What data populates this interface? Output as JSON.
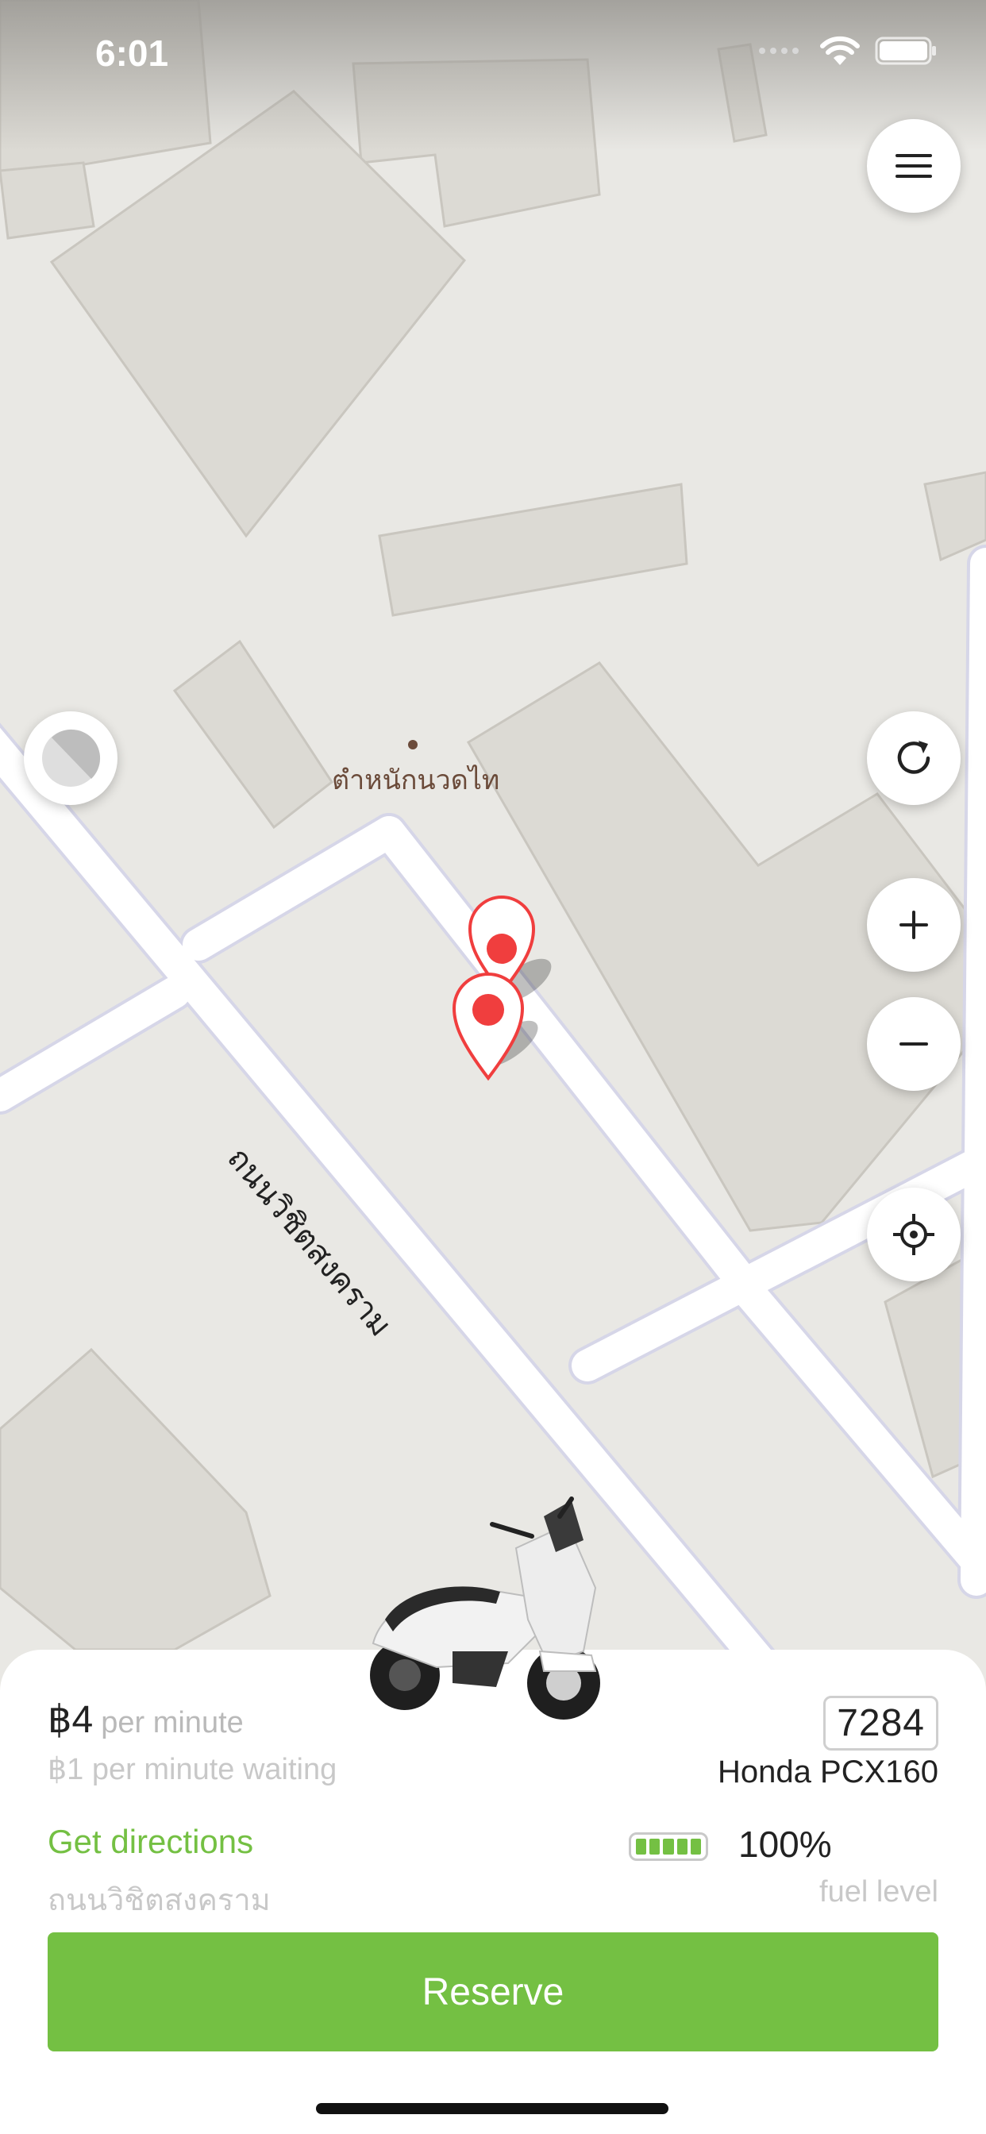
{
  "status_bar": {
    "time": "6:01"
  },
  "map": {
    "poi_label": "ตำหนักนวดไท",
    "road_label": "ถนนวิชิตสงคราม"
  },
  "controls": {
    "menu": "menu-icon",
    "refresh": "refresh-icon",
    "zoom_in": "plus-icon",
    "zoom_out": "minus-icon",
    "locate": "crosshair-icon"
  },
  "vehicle": {
    "price": "฿4",
    "price_unit": "per minute",
    "waiting": "฿1 per minute waiting",
    "plate": "7284",
    "model": "Honda PCX160",
    "directions_label": "Get directions",
    "street": "ถนนวิชิตสงคราม",
    "fuel_percent": "100%",
    "fuel_label": "fuel level",
    "fuel_level": 1.0
  },
  "actions": {
    "reserve_label": "Reserve"
  },
  "colors": {
    "accent": "#74c043",
    "pin": "#f03e3e"
  }
}
